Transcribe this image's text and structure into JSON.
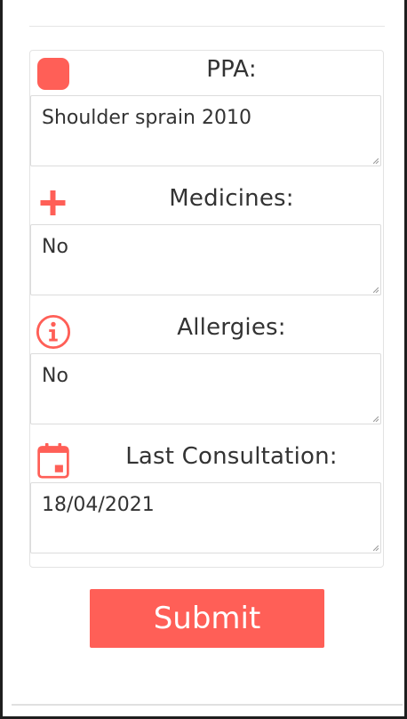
{
  "form": {
    "sections": [
      {
        "icon": "square-icon",
        "label": "PPA:",
        "value": "Shoulder sprain 2010"
      },
      {
        "icon": "plus-icon",
        "label": "Medicines:",
        "value": "No"
      },
      {
        "icon": "info-icon",
        "label": "Allergies:",
        "value": "No"
      },
      {
        "icon": "calendar-icon",
        "label": "Last Consultation:",
        "value": "18/04/2021"
      }
    ],
    "submit_label": "Submit"
  },
  "colors": {
    "accent": "#ff5f57",
    "text": "#333333",
    "border": "#dcdcdc"
  }
}
